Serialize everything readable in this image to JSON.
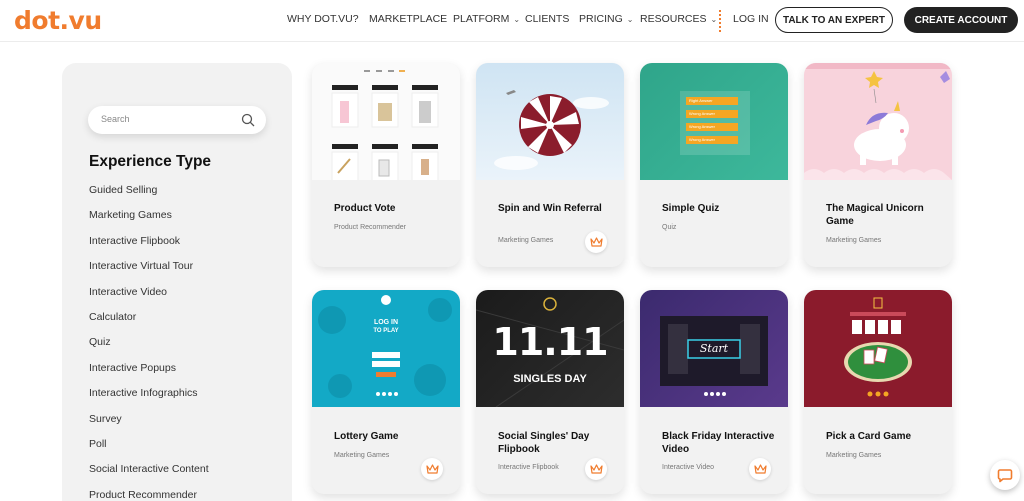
{
  "header": {
    "logo": "dot.vu",
    "nav": {
      "why": "WHY DOT.VU?",
      "marketplace": "MARKETPLACE",
      "platform": "PLATFORM",
      "clients": "CLIENTS",
      "pricing": "PRICING",
      "resources": "RESOURCES",
      "login": "LOG IN"
    },
    "talk_button": "TALK TO AN EXPERT",
    "create_button": "CREATE ACCOUNT"
  },
  "sidebar": {
    "search_placeholder": "Search",
    "title": "Experience Type",
    "items": [
      "Guided Selling",
      "Marketing Games",
      "Interactive Flipbook",
      "Interactive Virtual Tour",
      "Interactive Video",
      "Calculator",
      "Quiz",
      "Interactive Popups",
      "Interactive Infographics",
      "Survey",
      "Poll",
      "Social Interactive Content",
      "Product Recommender"
    ]
  },
  "cards": [
    {
      "title": "Product Vote",
      "subtitle": "Product Recommender",
      "premium": false
    },
    {
      "title": "Spin and Win Referral",
      "subtitle": "Marketing Games",
      "premium": true
    },
    {
      "title": "Simple Quiz",
      "subtitle": "Quiz",
      "premium": false
    },
    {
      "title": "The Magical Unicorn Game",
      "subtitle": "Marketing Games",
      "premium": false
    },
    {
      "title": "Lottery Game",
      "subtitle": "Marketing Games",
      "premium": true
    },
    {
      "title": "Social Singles' Day Flipbook",
      "subtitle": "Interactive Flipbook",
      "premium": true
    },
    {
      "title": "Black Friday Interactive Video",
      "subtitle": "Interactive Video",
      "premium": true
    },
    {
      "title": "Pick a Card Game",
      "subtitle": "Marketing Games",
      "premium": false
    }
  ],
  "thumbs": {
    "quiz_answers": [
      "Right Answer",
      "Wrong Answer",
      "Wrong Answer",
      "Wrong Answer"
    ],
    "lottery_heading": "LOG IN",
    "lottery_sub": "TO PLAY",
    "singles_number": "11.11",
    "singles_text": "SINGLES DAY",
    "bf_start": "Start"
  },
  "colors": {
    "brand": "#f07c2e",
    "dark": "#222222"
  }
}
